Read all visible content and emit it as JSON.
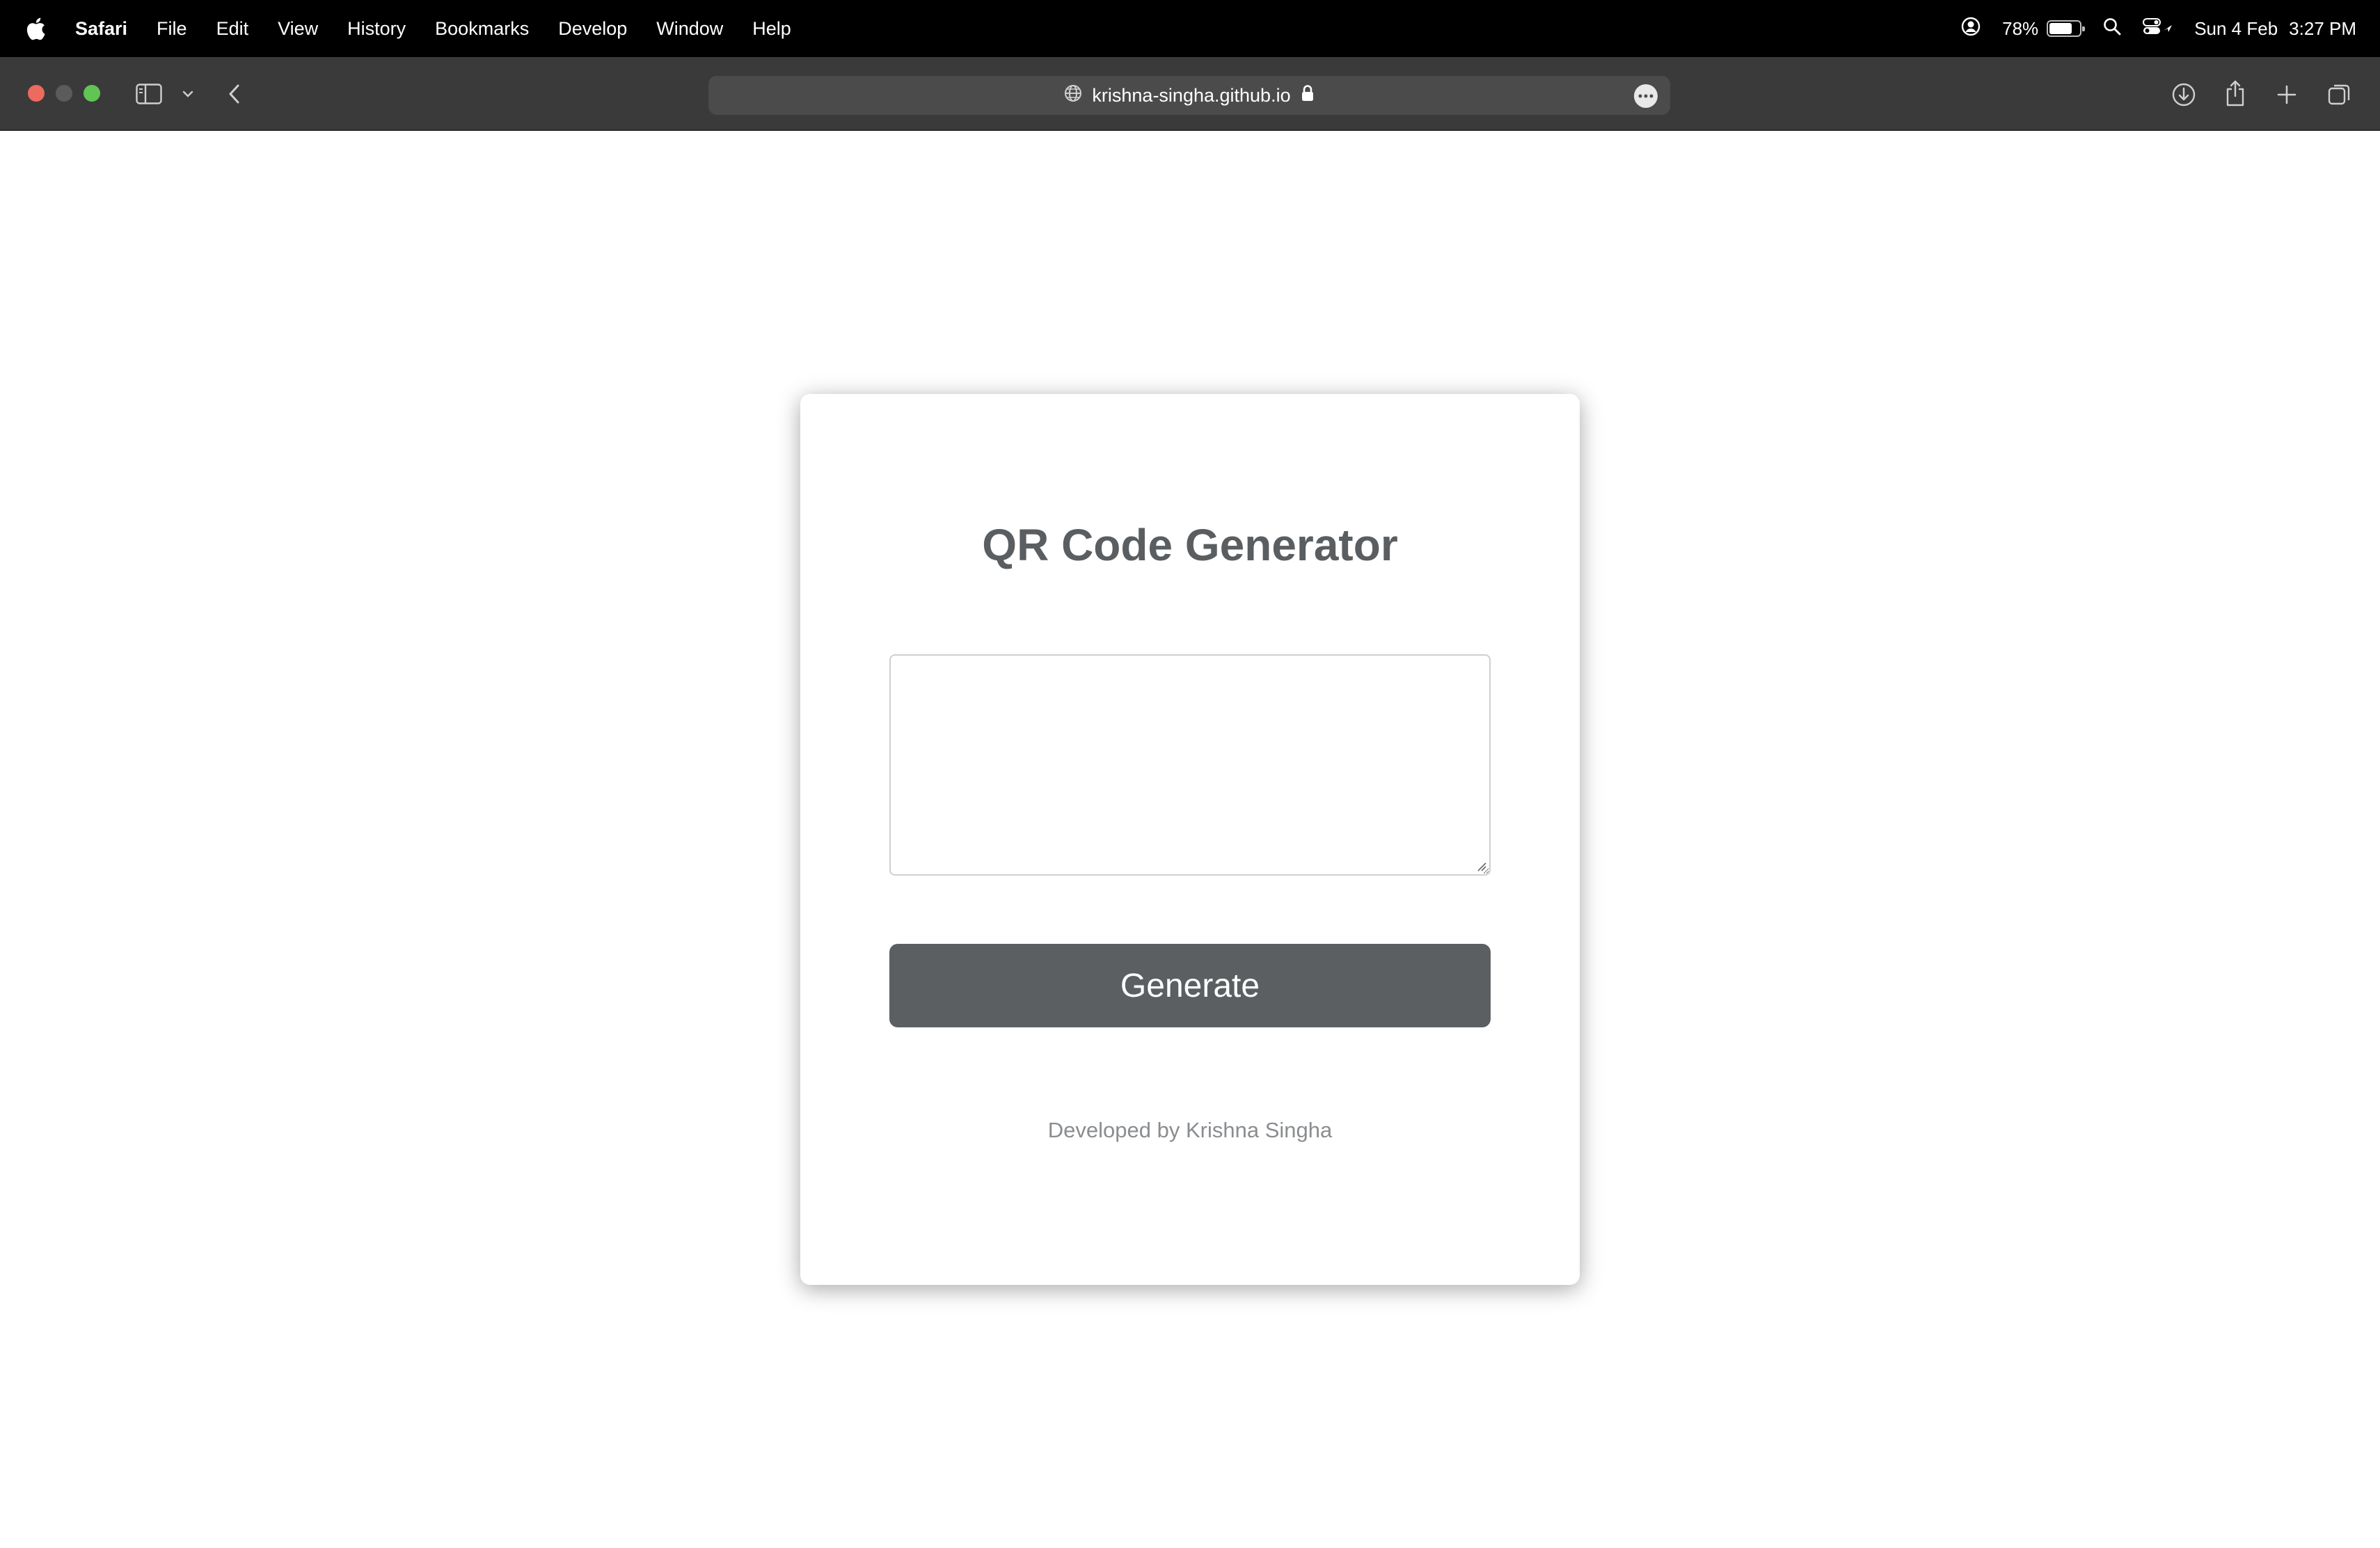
{
  "menubar": {
    "app_name": "Safari",
    "items": [
      "File",
      "Edit",
      "View",
      "History",
      "Bookmarks",
      "Develop",
      "Window",
      "Help"
    ],
    "battery_percent": "78%",
    "battery_level": 0.78,
    "date": "Sun 4 Feb",
    "time": "3:27 PM"
  },
  "browser": {
    "url": "krishna-singha.github.io",
    "traffic_colors": {
      "close": "#ed6a5e",
      "minimize": "#5b5b5b",
      "zoom": "#61c554"
    }
  },
  "page": {
    "title": "QR Code Generator",
    "input_value": "",
    "button_label": "Generate",
    "credit": "Developed by Krishna Singha",
    "colors": {
      "button": "#5b5f62",
      "title": "#5a5e61",
      "credit": "#8a8d90"
    }
  }
}
